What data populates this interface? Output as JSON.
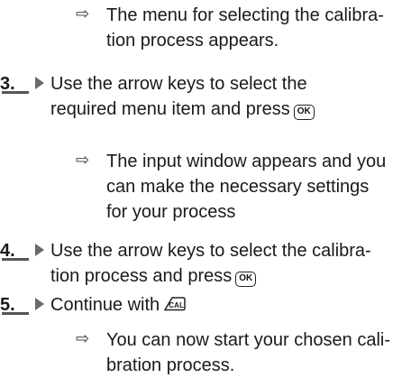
{
  "result_marker": "⇨",
  "steps_top": {
    "result": "The menu for selecting the calibra-\ntion process appears."
  },
  "step3": {
    "number": "3.",
    "line1": "Use the arrow keys to select the",
    "line2": "required menu item and press",
    "key": "OK",
    "result": "The input window appears and you can make the necessary settings for your process"
  },
  "step4": {
    "number": "4.",
    "line1": "Use the arrow keys to select the calibra-",
    "line2": "tion process and press",
    "key": "OK"
  },
  "step5": {
    "number": "5.",
    "text": "Continue with",
    "key": "CAL",
    "result": "You can now start your chosen cali-\nbration process."
  }
}
